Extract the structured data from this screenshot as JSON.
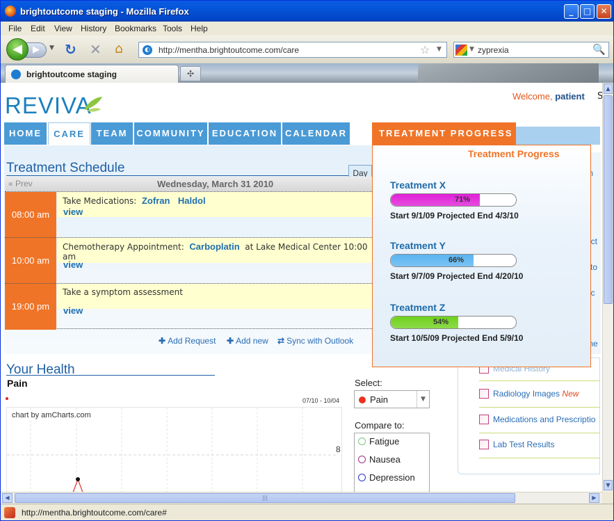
{
  "browser": {
    "window_title": "brightoutcome staging - Mozilla Firefox",
    "menu": [
      "File",
      "Edit",
      "View",
      "History",
      "Bookmarks",
      "Tools",
      "Help"
    ],
    "url": "http://mentha.brightoutcome.com/care",
    "search_value": "zyprexia",
    "tab_title": "brightoutcome staging",
    "status_text": "http://mentha.brightoutcome.com/care#"
  },
  "header": {
    "logo": "REVIVA",
    "welcome": "Welcome,",
    "user": "patient",
    "extra": "S"
  },
  "nav": [
    "HOME",
    "CARE",
    "TEAM",
    "COMMUNITY",
    "EDUCATION",
    "CALENDAR"
  ],
  "treatment_progress": {
    "tab_label": "TREATMENT PROGRESS ▾",
    "panel_title": "Treatment Progress",
    "items": [
      {
        "name": "Treatment X",
        "percent": 71,
        "percent_label": "71%",
        "color": "#e020d8",
        "dates": "Start 9/1/09  Projected End 4/3/10"
      },
      {
        "name": "Treatment Y",
        "percent": 66,
        "percent_label": "66%",
        "color": "#5ab4f0",
        "dates": "Start 9/7/09  Projected End 4/20/10"
      },
      {
        "name": "Treatment Z",
        "percent": 54,
        "percent_label": "54%",
        "color": "#6fd11c",
        "dates": "Start 10/5/09  Projected End 5/9/10"
      }
    ]
  },
  "schedule": {
    "title": "Treatment Schedule",
    "day_button": "Day",
    "prev": "« Prev",
    "date": "Wednesday, March 31 2010",
    "events": [
      {
        "time": "08:00 am",
        "prefix": "Take Medications:",
        "highlights": [
          "Zofran",
          "Haldol"
        ],
        "suffix": "",
        "view": "view"
      },
      {
        "time": "10:00 am",
        "prefix": "Chemotherapy Appointment:",
        "highlights": [
          "Carboplatin"
        ],
        "suffix": "at Lake Medical Center 10:00 am",
        "view": "view"
      },
      {
        "time": "19:00 pm",
        "prefix": "Take a symptom assessment",
        "highlights": [],
        "suffix": "",
        "view": "view"
      }
    ],
    "actions": [
      "Add Request",
      "Add new",
      "Sync with Outlook"
    ]
  },
  "health": {
    "title": "Your Health",
    "chart_title": "Pain",
    "range": "07/10 - 10/04",
    "credit": "chart by amCharts.com",
    "y_label": "8",
    "select_label": "Select:",
    "selected": "Pain",
    "compare_label": "Compare to:",
    "compare": [
      {
        "label": "Fatigue",
        "color": "#7fbf7f"
      },
      {
        "label": "Nausea",
        "color": "#9a2f8e"
      },
      {
        "label": "Depression",
        "color": "#2537c9"
      }
    ]
  },
  "right_links": {
    "items": [
      {
        "label": "Medical History",
        "badge": ""
      },
      {
        "label": "Radiology Images",
        "badge": "New"
      },
      {
        "label": "Medications and Prescriptio",
        "badge": ""
      },
      {
        "label": "Lab Test Results",
        "badge": ""
      }
    ],
    "fragments": [
      "m",
      "oct",
      "cto",
      "oc",
      "me"
    ]
  }
}
